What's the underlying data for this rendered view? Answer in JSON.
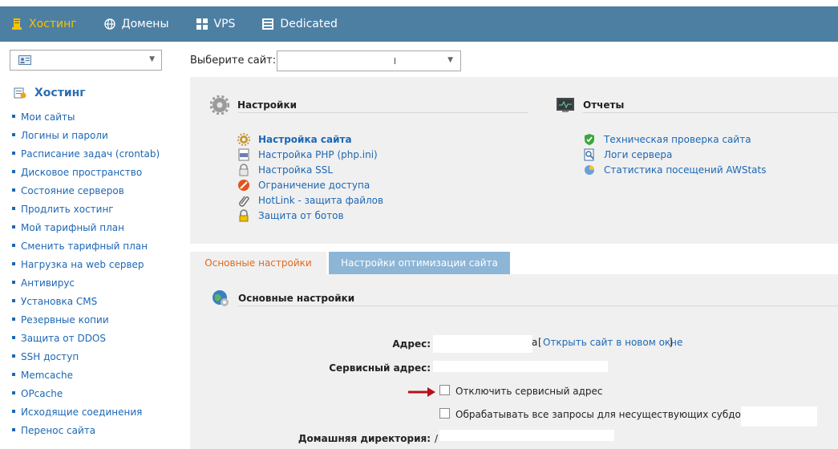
{
  "topnav": {
    "items": [
      {
        "label": "Хостинг",
        "icon": "server-icon",
        "active": true
      },
      {
        "label": "Домены",
        "icon": "globe-icon"
      },
      {
        "label": "VPS",
        "icon": "blocks-icon"
      },
      {
        "label": "Dedicated",
        "icon": "rack-icon"
      }
    ]
  },
  "sidebar": {
    "title": "Хостинг",
    "items": [
      "Мои сайты",
      "Логины и пароли",
      "Расписание задач (crontab)",
      "Дисковое пространство",
      "Состояние серверов",
      "Продлить хостинг",
      "Мой тарифный план",
      "Сменить тарифный план",
      "Нагрузка на web сервер",
      "Антивирус",
      "Установка CMS",
      "Резервные копии",
      "Защита от DDOS",
      "SSH доступ",
      "Memcache",
      "OPcache",
      "Исходящие соединения",
      "Перенос сайта"
    ]
  },
  "site_chooser": {
    "label": "Выберите сайт:",
    "value": ""
  },
  "settings": {
    "title": "Настройки",
    "links": [
      {
        "label": "Настройка сайта",
        "icon": "gear-icon",
        "bold": true
      },
      {
        "label": "Настройка PHP (php.ini)",
        "icon": "php-file-icon"
      },
      {
        "label": "Настройка SSL",
        "icon": "lock-icon"
      },
      {
        "label": "Ограничение доступа",
        "icon": "forbidden-icon"
      },
      {
        "label": "HotLink - защита файлов",
        "icon": "paperclip-icon"
      },
      {
        "label": "Защита от ботов",
        "icon": "padlock-icon"
      }
    ]
  },
  "reports": {
    "title": "Отчеты",
    "links": [
      {
        "label": "Техническая проверка сайта",
        "icon": "shield-check-icon"
      },
      {
        "label": "Логи сервера",
        "icon": "log-icon"
      },
      {
        "label": "Статистика посещений AWStats",
        "icon": "pie-chart-icon"
      }
    ]
  },
  "tabs": {
    "active": "Основные настройки",
    "inactive": "Настройки оптимизации сайта"
  },
  "basic": {
    "title": "Основные настройки",
    "address_label": "Адрес:",
    "address_value_tail": "a",
    "open_link_prefix": "[",
    "open_link": "Открыть сайт в новом окне",
    "open_link_suffix": "]",
    "service_label": "Сервисный адрес:",
    "disable_service": "Отключить сервисный адрес",
    "process_all": "Обрабатывать все запросы для несуществующих субдоменов",
    "home_label": "Домашняя директория:",
    "home_value_prefix": "/"
  },
  "colors": {
    "nav_bg": "#4d7fa3",
    "active_nav": "#f5c400",
    "link": "#1d67b4",
    "tab_active_text": "#e06a1c",
    "tab_inactive_bg": "#8db5d6",
    "panel_bg": "#f0f0f0",
    "arrow": "#b5121b"
  }
}
